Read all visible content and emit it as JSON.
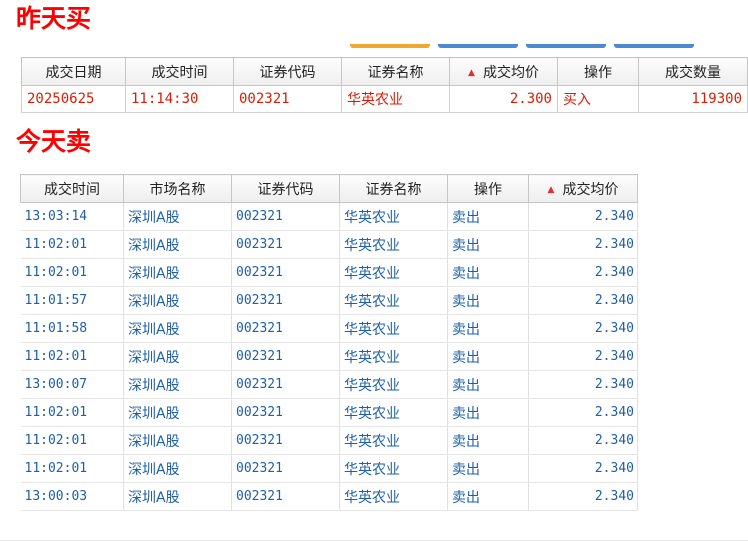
{
  "yesterday": {
    "title": "昨天买",
    "columns": [
      "成交日期",
      "成交时间",
      "证券代码",
      "证券名称",
      "成交均价",
      "操作",
      "成交数量"
    ],
    "sort_column": "成交均价",
    "rows": [
      {
        "date": "20250625",
        "time": "11:14:30",
        "code": "002321",
        "name": "华英农业",
        "price": "2.300",
        "action": "买入",
        "qty": "119300"
      }
    ]
  },
  "today": {
    "title": "今天卖",
    "columns": [
      "成交时间",
      "市场名称",
      "证券代码",
      "证券名称",
      "操作",
      "成交均价"
    ],
    "sort_column": "成交均价",
    "rows": [
      {
        "time": "13:03:14",
        "market": "深圳A股",
        "code": "002321",
        "name": "华英农业",
        "action": "卖出",
        "price": "2.340"
      },
      {
        "time": "11:02:01",
        "market": "深圳A股",
        "code": "002321",
        "name": "华英农业",
        "action": "卖出",
        "price": "2.340"
      },
      {
        "time": "11:02:01",
        "market": "深圳A股",
        "code": "002321",
        "name": "华英农业",
        "action": "卖出",
        "price": "2.340"
      },
      {
        "time": "11:01:57",
        "market": "深圳A股",
        "code": "002321",
        "name": "华英农业",
        "action": "卖出",
        "price": "2.340"
      },
      {
        "time": "11:01:58",
        "market": "深圳A股",
        "code": "002321",
        "name": "华英农业",
        "action": "卖出",
        "price": "2.340"
      },
      {
        "time": "11:02:01",
        "market": "深圳A股",
        "code": "002321",
        "name": "华英农业",
        "action": "卖出",
        "price": "2.340"
      },
      {
        "time": "13:00:07",
        "market": "深圳A股",
        "code": "002321",
        "name": "华英农业",
        "action": "卖出",
        "price": "2.340"
      },
      {
        "time": "11:02:01",
        "market": "深圳A股",
        "code": "002321",
        "name": "华英农业",
        "action": "卖出",
        "price": "2.340"
      },
      {
        "time": "11:02:01",
        "market": "深圳A股",
        "code": "002321",
        "name": "华英农业",
        "action": "卖出",
        "price": "2.340"
      },
      {
        "time": "11:02:01",
        "market": "深圳A股",
        "code": "002321",
        "name": "华英农业",
        "action": "卖出",
        "price": "2.340"
      },
      {
        "time": "13:00:03",
        "market": "深圳A股",
        "code": "002321",
        "name": "华英农业",
        "action": "卖出",
        "price": "2.340"
      }
    ]
  },
  "colors": {
    "title": "#ff0000",
    "buy_text": "#d81e06",
    "sell_text": "#1f5fa8",
    "sort_indicator": "#e03030"
  },
  "icons": {
    "sort_indicator": "sort-asc-icon"
  }
}
